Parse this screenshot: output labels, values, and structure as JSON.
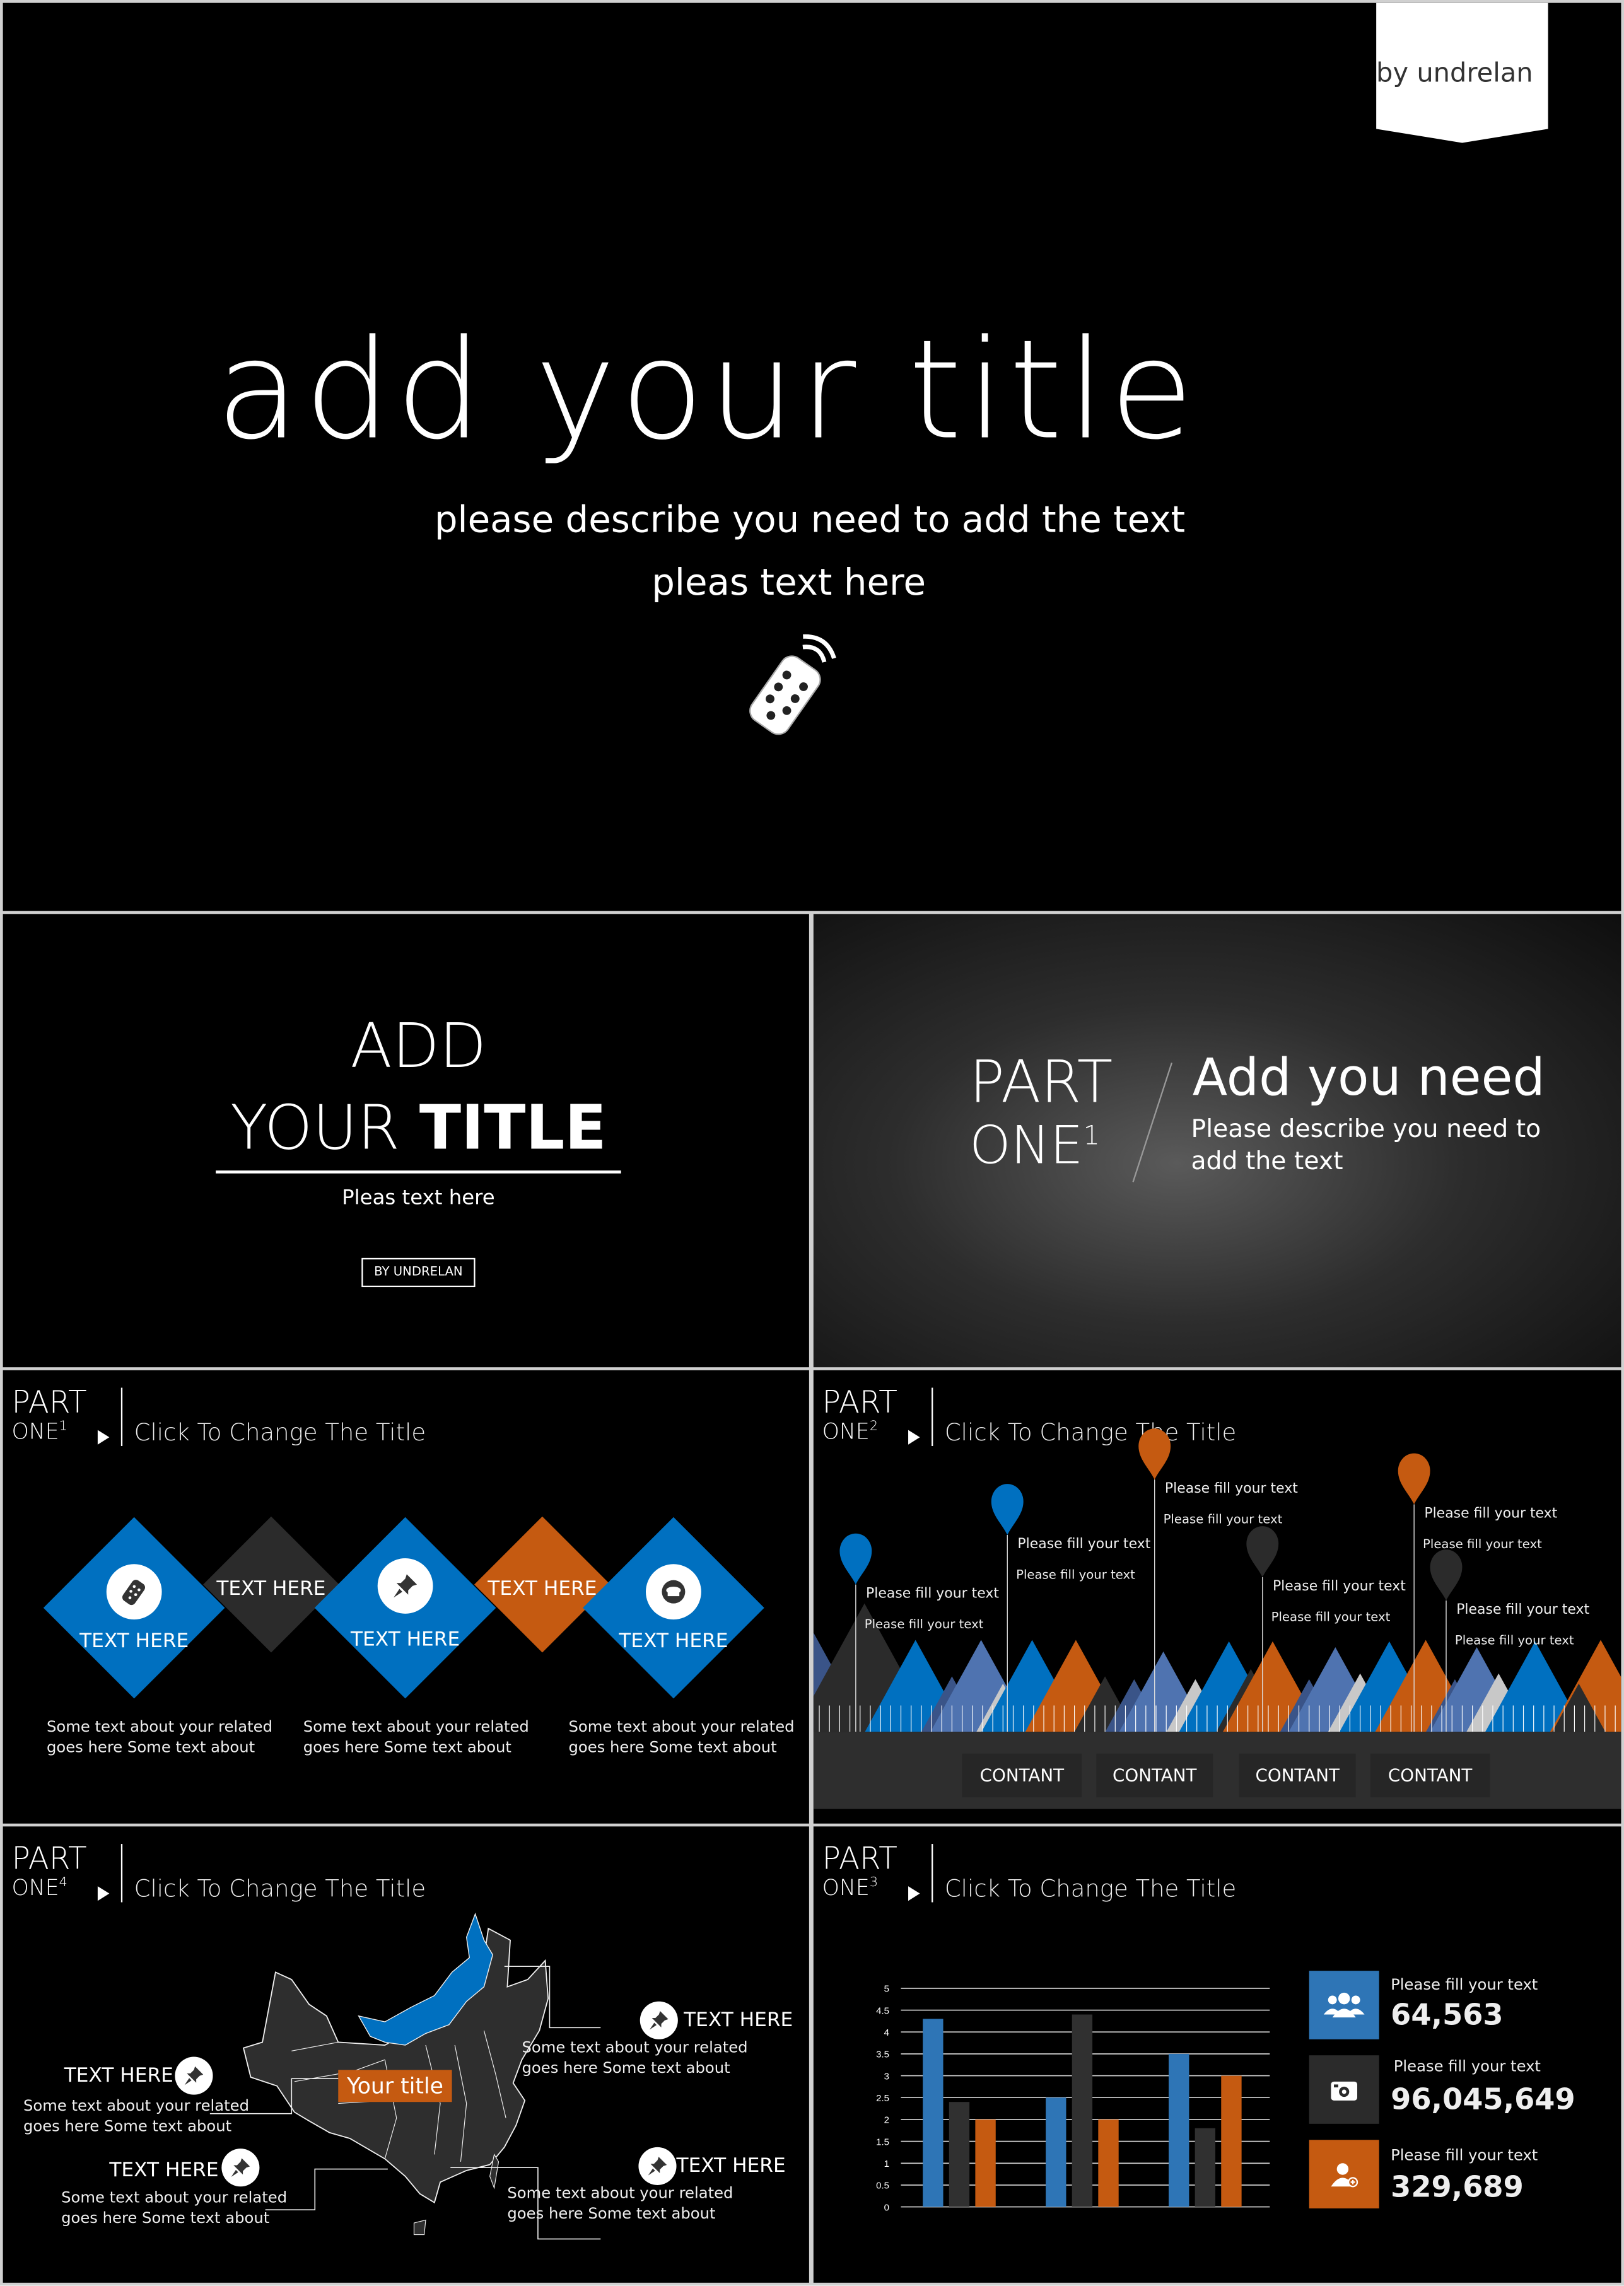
{
  "colors": {
    "blue": "#0070c0",
    "orange": "#c55a11",
    "dark": "#2b2b2b",
    "chart_blue": "#2e75b6",
    "chart_dark": "#303030",
    "chart_orange": "#c55a11"
  },
  "cover": {
    "badge": "by undrelan",
    "title": "add your title",
    "subtitle_line1": "please describe you need to add the text",
    "subtitle_line2": "pleas text here",
    "icon": "remote-control-icon"
  },
  "title_slide": {
    "line1": "ADD",
    "line2_regular": "YOUR ",
    "line2_bold": "TITLE",
    "subtitle": "Pleas text here",
    "author_button": "BY UNDRELAN"
  },
  "section_slide": {
    "part": "PART",
    "one": "ONE",
    "number": "1",
    "heading": "Add you need",
    "description_line1": "Please describe you need to",
    "description_line2": "add the text"
  },
  "slide_diamonds": {
    "header": {
      "part": "PART",
      "one": "ONE",
      "number": "1",
      "title": "Click To Change The Title"
    },
    "items": [
      {
        "label": "TEXT HERE",
        "icon": "remote-control-icon"
      },
      {
        "label": "TEXT HERE"
      },
      {
        "label": "TEXT HERE",
        "icon": "pushpin-icon"
      },
      {
        "label": "TEXT HERE"
      },
      {
        "label": "TEXT HERE",
        "icon": "coffee-cup-icon"
      }
    ],
    "captions": [
      {
        "line1": "Some text about your related",
        "line2": "goes here Some text about"
      },
      {
        "line1": "Some text about your related",
        "line2": "goes here Some text about"
      },
      {
        "line1": "Some text about your related",
        "line2": "goes here Some text about"
      }
    ]
  },
  "slide_balloons": {
    "header": {
      "part": "PART",
      "one": "ONE",
      "number": "2",
      "title": "Click To Change The Title"
    },
    "balloons": [
      {
        "color": "blue",
        "title": "Please fill your text",
        "text": "Please fill your text"
      },
      {
        "color": "blue",
        "title": "Please fill your text",
        "text": "Please fill your text"
      },
      {
        "color": "orange",
        "title": "Please fill your text",
        "text": "Please fill your text"
      },
      {
        "color": "dark",
        "title": "Please fill your text",
        "text": "Please fill your text"
      },
      {
        "color": "orange",
        "title": "Please fill your text",
        "text": "Please fill your text"
      },
      {
        "color": "dark",
        "title": "Please fill your text",
        "text": "Please fill your text"
      }
    ],
    "buttons": [
      "CONTANT",
      "CONTANT",
      "CONTANT",
      "CONTANT"
    ]
  },
  "slide_map": {
    "header": {
      "part": "PART",
      "one": "ONE",
      "number": "4",
      "title": "Click To Change The Title"
    },
    "map_label": "Your title",
    "callouts": [
      {
        "title": "TEXT HERE",
        "line1": "Some text about your related",
        "line2": "goes here Some text about"
      },
      {
        "title": "TEXT HERE",
        "line1": "Some text about your related",
        "line2": "goes here Some text about"
      },
      {
        "title": "TEXT HERE",
        "line1": "Some text about your related",
        "line2": "goes here Some text about"
      },
      {
        "title": "TEXT HERE",
        "line1": "Some text about your related",
        "line2": "goes here Some text about"
      }
    ]
  },
  "slide_chart": {
    "header": {
      "part": "PART",
      "one": "ONE",
      "number": "3",
      "title": "Click To Change The Title"
    },
    "stats": [
      {
        "label": "Please fill your text",
        "value": "64,563",
        "icon": "users-group-icon",
        "color": "#2e75b6"
      },
      {
        "label": "Please fill your text",
        "value": "96,045,649",
        "icon": "camera-icon",
        "color": "#2b2b2b"
      },
      {
        "label": "Please fill your text",
        "value": "329,689",
        "icon": "add-user-icon",
        "color": "#c55a11"
      }
    ]
  },
  "chart_data": {
    "type": "bar",
    "categories": [
      "",
      "",
      ""
    ],
    "series": [
      {
        "values": [
          4.3,
          2.5,
          3.5
        ],
        "color": "#2e75b6"
      },
      {
        "values": [
          2.4,
          4.4,
          1.8
        ],
        "color": "#303030"
      },
      {
        "values": [
          2.0,
          2.0,
          3.0
        ],
        "color": "#c55a11"
      }
    ],
    "ylim": [
      0,
      5
    ],
    "yticks": [
      "0",
      "0.5",
      "1",
      "1.5",
      "2",
      "2.5",
      "3",
      "3.5",
      "4",
      "4.5",
      "5"
    ],
    "grid": true,
    "legend": "none"
  }
}
